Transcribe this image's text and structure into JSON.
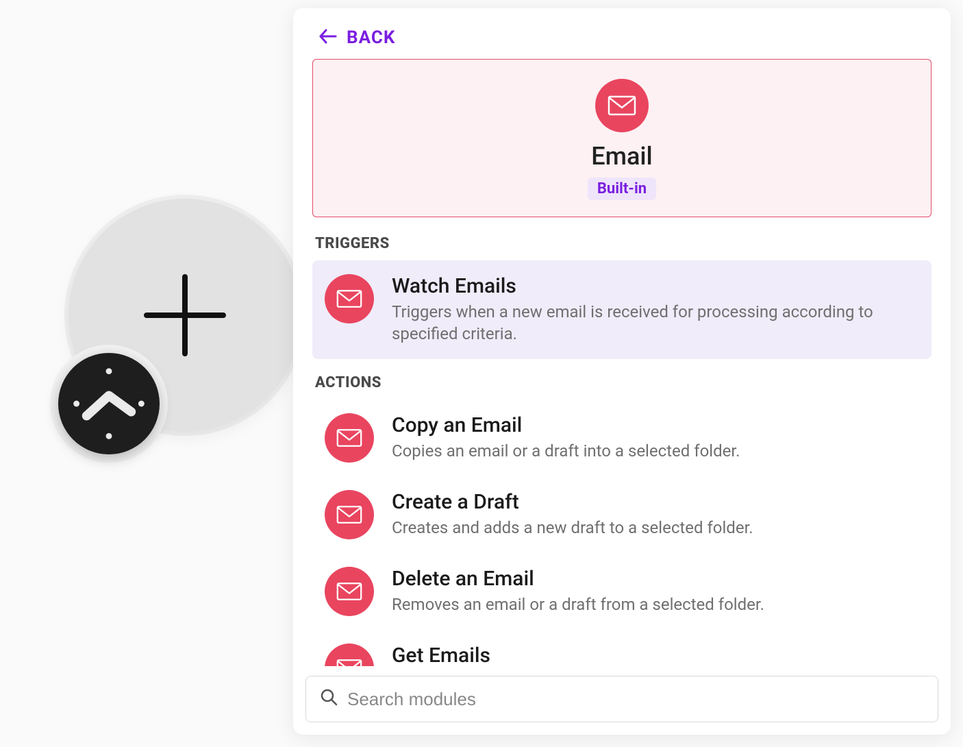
{
  "panel": {
    "back_label": "BACK"
  },
  "app": {
    "title": "Email",
    "badge": "Built-in"
  },
  "sections": {
    "triggers_label": "TRIGGERS",
    "actions_label": "ACTIONS"
  },
  "triggers": [
    {
      "title": "Watch Emails",
      "desc": "Triggers when a new email is received for processing according to specified criteria."
    }
  ],
  "actions": [
    {
      "title": "Copy an Email",
      "desc": "Copies an email or a draft into a selected folder."
    },
    {
      "title": "Create a Draft",
      "desc": "Creates and adds a new draft to a selected folder."
    },
    {
      "title": "Delete an Email",
      "desc": "Removes an email or a draft from a selected folder."
    },
    {
      "title": "Get Emails",
      "desc": ""
    }
  ],
  "search": {
    "placeholder": "Search modules"
  },
  "colors": {
    "accent": "#7a1fe0",
    "email_app": "#e9455f"
  }
}
